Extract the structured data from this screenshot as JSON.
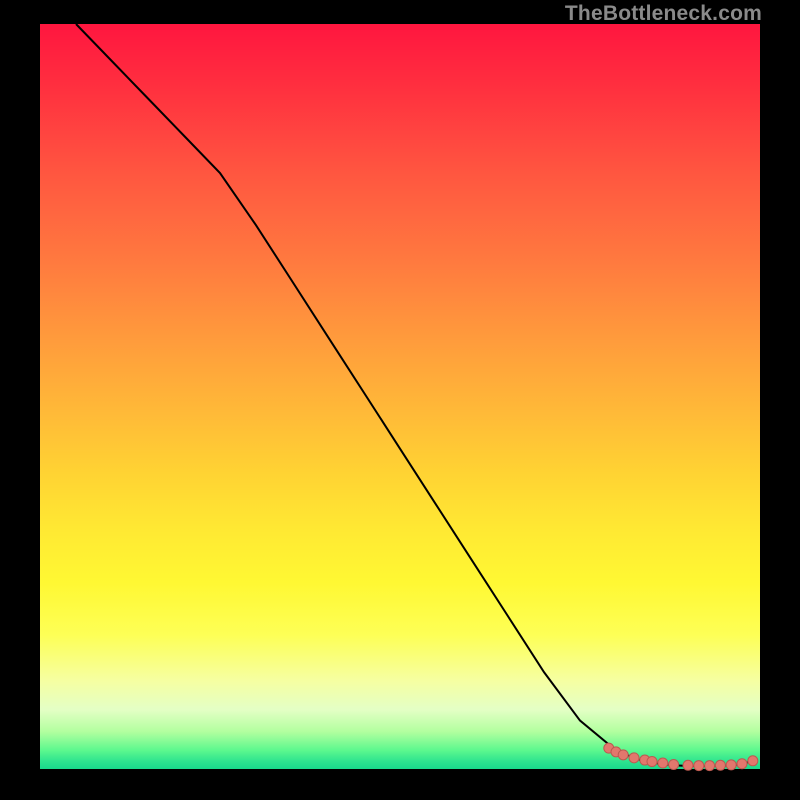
{
  "attribution": "TheBottleneck.com",
  "chart_data": {
    "type": "line",
    "title": "",
    "xlabel": "",
    "ylabel": "",
    "xlim": [
      0,
      100
    ],
    "ylim": [
      0,
      100
    ],
    "grid": false,
    "legend": false,
    "series": [
      {
        "name": "curve",
        "mode": "line",
        "color": "#000000",
        "x": [
          5,
          10,
          15,
          20,
          25,
          30,
          35,
          40,
          45,
          50,
          55,
          60,
          65,
          70,
          75,
          80,
          83,
          86,
          88,
          90,
          92,
          94,
          96,
          97,
          98,
          99.5
        ],
        "y": [
          100,
          95,
          90,
          85,
          80,
          73,
          65.5,
          58,
          50.5,
          43,
          35.5,
          28,
          20.5,
          13,
          6.5,
          2.5,
          1.3,
          0.7,
          0.5,
          0.4,
          0.4,
          0.4,
          0.5,
          0.6,
          0.8,
          1.3
        ]
      },
      {
        "name": "markers",
        "mode": "scatter",
        "color": "#e2776d",
        "x": [
          79,
          80,
          81,
          82.5,
          84,
          85,
          86.5,
          88,
          90,
          91.5,
          93,
          94.5,
          96,
          97.5,
          99
        ],
        "y": [
          2.8,
          2.3,
          1.9,
          1.5,
          1.2,
          1.0,
          0.8,
          0.6,
          0.5,
          0.45,
          0.45,
          0.5,
          0.55,
          0.7,
          1.1
        ]
      }
    ]
  }
}
